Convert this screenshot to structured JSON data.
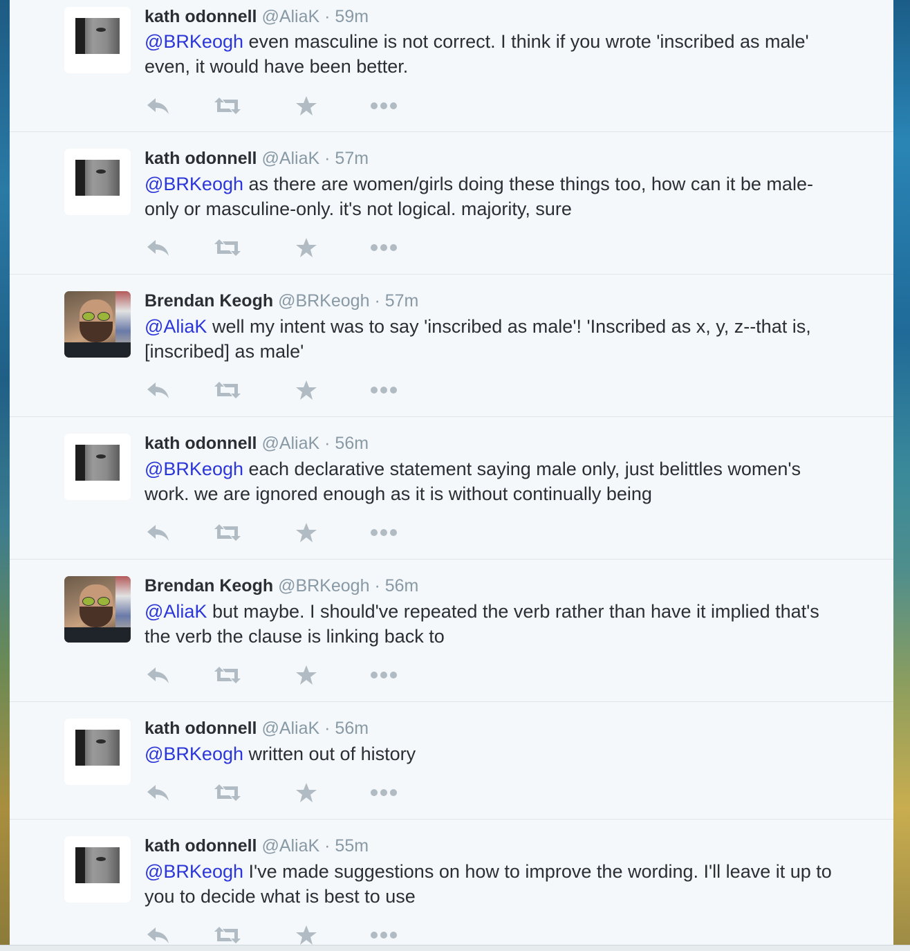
{
  "tweets": [
    {
      "author": "kath odonnell",
      "handle": "@AliaK",
      "time": "· 59m",
      "mention": "@BRKeogh",
      "text": " even masculine is not correct. I think if you wrote 'inscribed as male' even, it would have been better."
    },
    {
      "author": "kath odonnell",
      "handle": "@AliaK",
      "time": "· 57m",
      "mention": "@BRKeogh",
      "text": " as there are women/girls doing these things too, how can it be male-only or masculine-only. it's not logical. majority, sure"
    },
    {
      "author": "Brendan Keogh",
      "handle": "@BRKeogh",
      "time": "· 57m",
      "mention": "@AliaK",
      "text": " well my intent was to say 'inscribed as male'! 'Inscribed as x, y, z--that is, [inscribed] as male'"
    },
    {
      "author": "kath odonnell",
      "handle": "@AliaK",
      "time": "· 56m",
      "mention": "@BRKeogh",
      "text": " each declarative statement saying male only, just belittles women's work. we are ignored enough as it is without continually being"
    },
    {
      "author": "Brendan Keogh",
      "handle": "@BRKeogh",
      "time": "· 56m",
      "mention": "@AliaK",
      "text": " but maybe. I should've repeated the verb rather than have it implied that's the verb the clause is linking back to"
    },
    {
      "author": "kath odonnell",
      "handle": "@AliaK",
      "time": "· 56m",
      "mention": "@BRKeogh",
      "text": " written out of history"
    },
    {
      "author": "kath odonnell",
      "handle": "@AliaK",
      "time": "· 55m",
      "mention": "@BRKeogh",
      "text": " I've made suggestions on how to improve the wording. I'll leave it up to you to decide what is best to use"
    }
  ],
  "icons": {
    "reply": "reply-icon",
    "retweet": "retweet-icon",
    "favorite": "star-icon",
    "more": "more-dots-icon"
  },
  "colors": {
    "mention": "#2b36d9",
    "name": "#292f33",
    "meta": "#8899a6",
    "action_icon": "#b1bbc3",
    "background": "#f5f8fa"
  }
}
